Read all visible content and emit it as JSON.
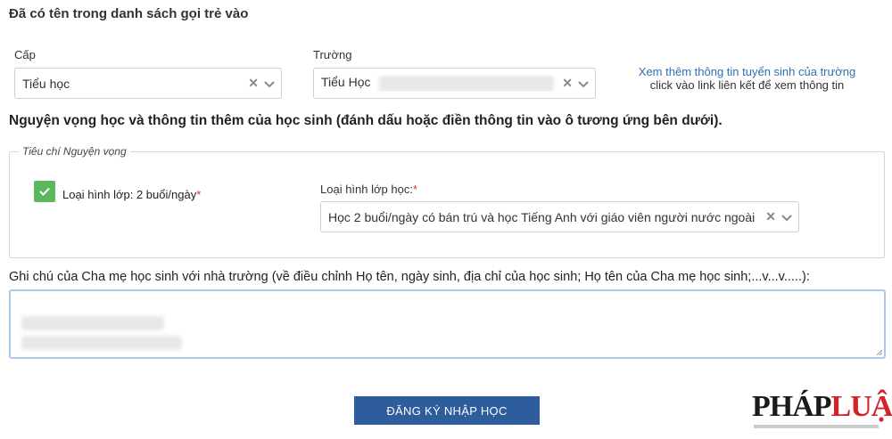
{
  "header_note": "Đã có tên trong danh sách gọi trẻ vào",
  "cap": {
    "label": "Cấp",
    "value": "Tiểu học"
  },
  "truong": {
    "label": "Trường",
    "value": "Tiểu Học"
  },
  "info_link": {
    "link_text": "Xem thêm thông tin tuyển sinh của trường",
    "hint_text": "click vào link liên kết để xem thông tin"
  },
  "section_title": "Nguyện vọng học và thông tin thêm của học sinh (đánh dấu hoặc điền thông tin vào ô tương ứng bên dưới).",
  "criteria": {
    "legend": "Tiêu chí Nguyện vọng",
    "checkbox_label": "Loại hình lớp: 2 buổi/ngày",
    "class_type_label": "Loại hình lớp học:",
    "class_type_value": "Học 2 buổi/ngày có bán trú và học Tiếng Anh với giáo viên người nước ngoài",
    "required_mark": "*"
  },
  "notes": {
    "label": "Ghi chú của Cha mẹ học sinh với nhà trường (về điều chỉnh Họ tên, ngày sinh, địa chỉ của học sinh; Họ tên của Cha mẹ học sinh;...v...v.....):"
  },
  "submit_label": "ĐĂNG KÝ NHẬP HỌC",
  "logo": {
    "text_dark": "PHÁP",
    "text_red": "LUẬT"
  },
  "colors": {
    "primary_button": "#2e5d9e",
    "checkbox_green": "#5cb85c",
    "link_blue": "#2f6fb5",
    "required_red": "#d9362a"
  }
}
